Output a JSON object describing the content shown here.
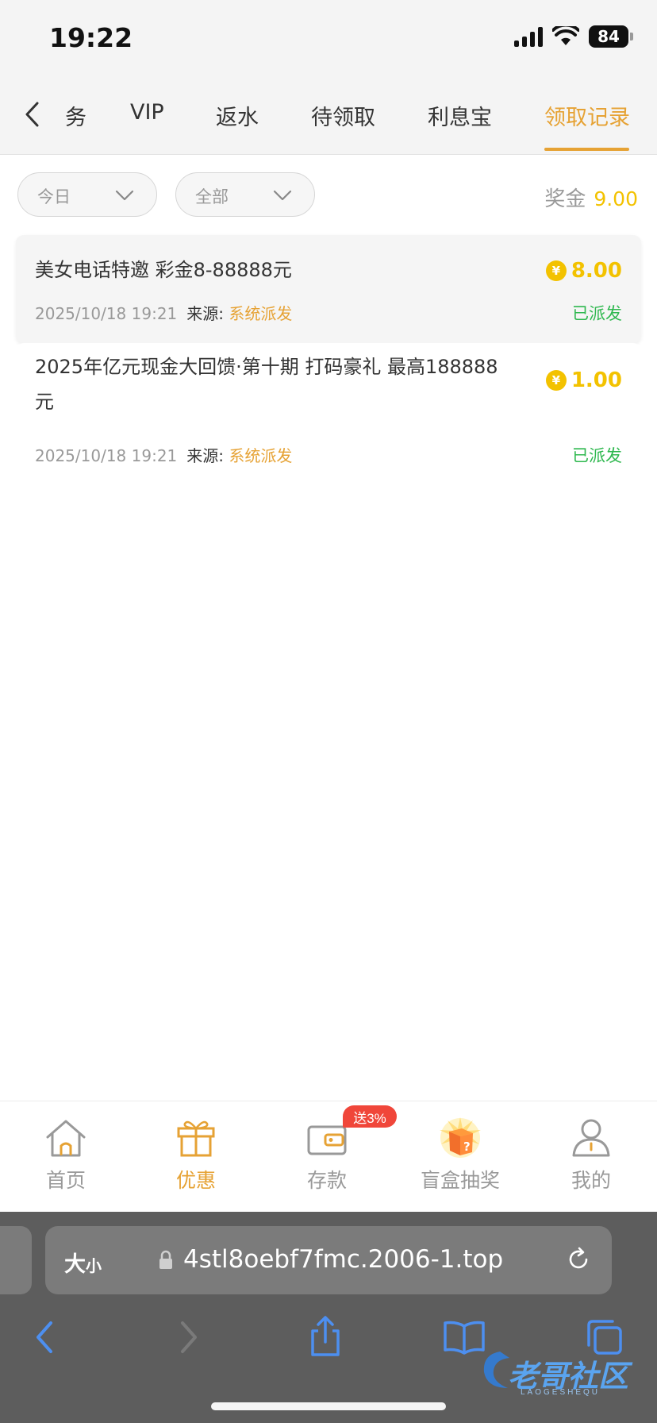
{
  "status_bar": {
    "time": "19:22",
    "battery": "84"
  },
  "tabs": {
    "partial_tab": "务",
    "items": [
      {
        "label": "VIP"
      },
      {
        "label": "返水"
      },
      {
        "label": "待领取"
      },
      {
        "label": "利息宝"
      },
      {
        "label": "领取记录"
      }
    ],
    "active_index": 4,
    "accent": "#e6a234"
  },
  "filters": {
    "date": "今日",
    "type": "全部"
  },
  "bonus": {
    "label": "奖金",
    "value": "9.00"
  },
  "records": [
    {
      "title": "美女电话特邀 彩金8-88888元",
      "amount": "8.00",
      "time": "2025/10/18 19:21",
      "source_label": "来源:",
      "source": "系统派发",
      "status": "已派发"
    },
    {
      "title_line1": "2025年亿元现金大回馈·第十期 打码豪礼 最高188888",
      "title_line2": "元",
      "amount": "1.00",
      "time": "2025/10/18 19:21",
      "source_label": "来源:",
      "source": "系统派发",
      "status": "已派发"
    }
  ],
  "coin_symbol": "¥",
  "bottom_nav": {
    "items": [
      {
        "label": "首页",
        "icon": "home-icon"
      },
      {
        "label": "优惠",
        "icon": "gift-icon"
      },
      {
        "label": "存款",
        "icon": "wallet-icon"
      },
      {
        "label": "盲盒抽奖",
        "icon": "mystery-box-icon"
      },
      {
        "label": "我的",
        "icon": "user-icon"
      }
    ],
    "active_index": 1,
    "deposit_badge": "送3%"
  },
  "browser": {
    "text_size_label": "大",
    "text_size_small": "小",
    "url": "4stl8oebf7fmc.2006-1.top"
  },
  "watermark": {
    "text": "老哥社区",
    "sub": "LAOGESHEQU"
  }
}
